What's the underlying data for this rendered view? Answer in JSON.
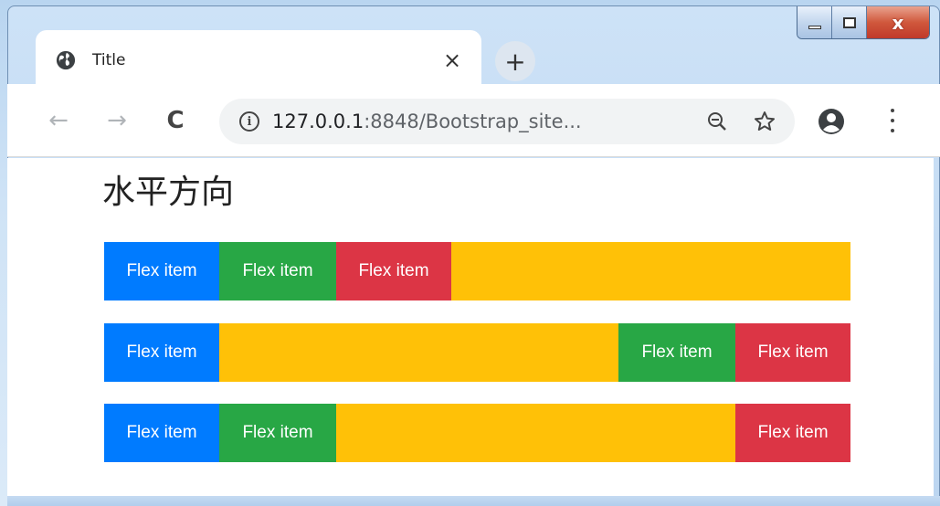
{
  "tab": {
    "title": "Title",
    "close": "×"
  },
  "new_tab": "+",
  "window_controls": {
    "close": "x"
  },
  "toolbar": {
    "back": "←",
    "forward": "→",
    "reload": "C",
    "info": "i",
    "url_host": "127.0.0.1",
    "url_rest": ":8848/Bootstrap_site..."
  },
  "page": {
    "heading": "水平方向",
    "item_label": "Flex item"
  },
  "colors": {
    "blue": "#007bff",
    "green": "#28a745",
    "red": "#dc3545",
    "yellow": "#ffc107"
  }
}
